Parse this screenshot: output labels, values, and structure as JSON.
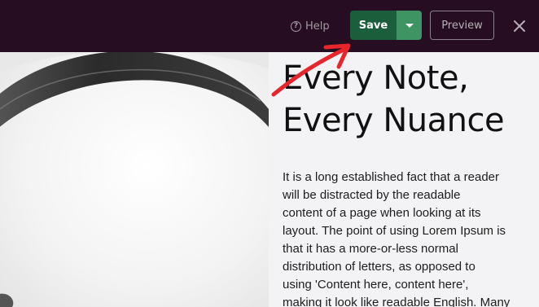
{
  "toolbar": {
    "help_label": "Help",
    "save_label": "Save",
    "preview_label": "Preview",
    "colors": {
      "bar_bg": "#260d22",
      "save_bg": "#1b5e3c",
      "save_caret_bg": "#3f9464",
      "arrow": "#e6262b"
    }
  },
  "icons": {
    "help": "question-circle-icon",
    "save_caret": "caret-down-icon",
    "close": "close-icon",
    "annotation": "red-arrow-icon",
    "hero": "headphones-photo"
  },
  "content": {
    "headline_lines": [
      "Every Note,",
      "Every Nuance"
    ],
    "body_lines": [
      "It is a long established fact that a reader",
      "will be distracted by the readable",
      "content of a page when looking at its",
      "layout. The point of using Lorem Ipsum is",
      "that it has a more-or-less normal",
      "distribution of letters, as opposed to",
      "using 'Content here, content here',",
      "making it look like readable English. Many"
    ]
  }
}
